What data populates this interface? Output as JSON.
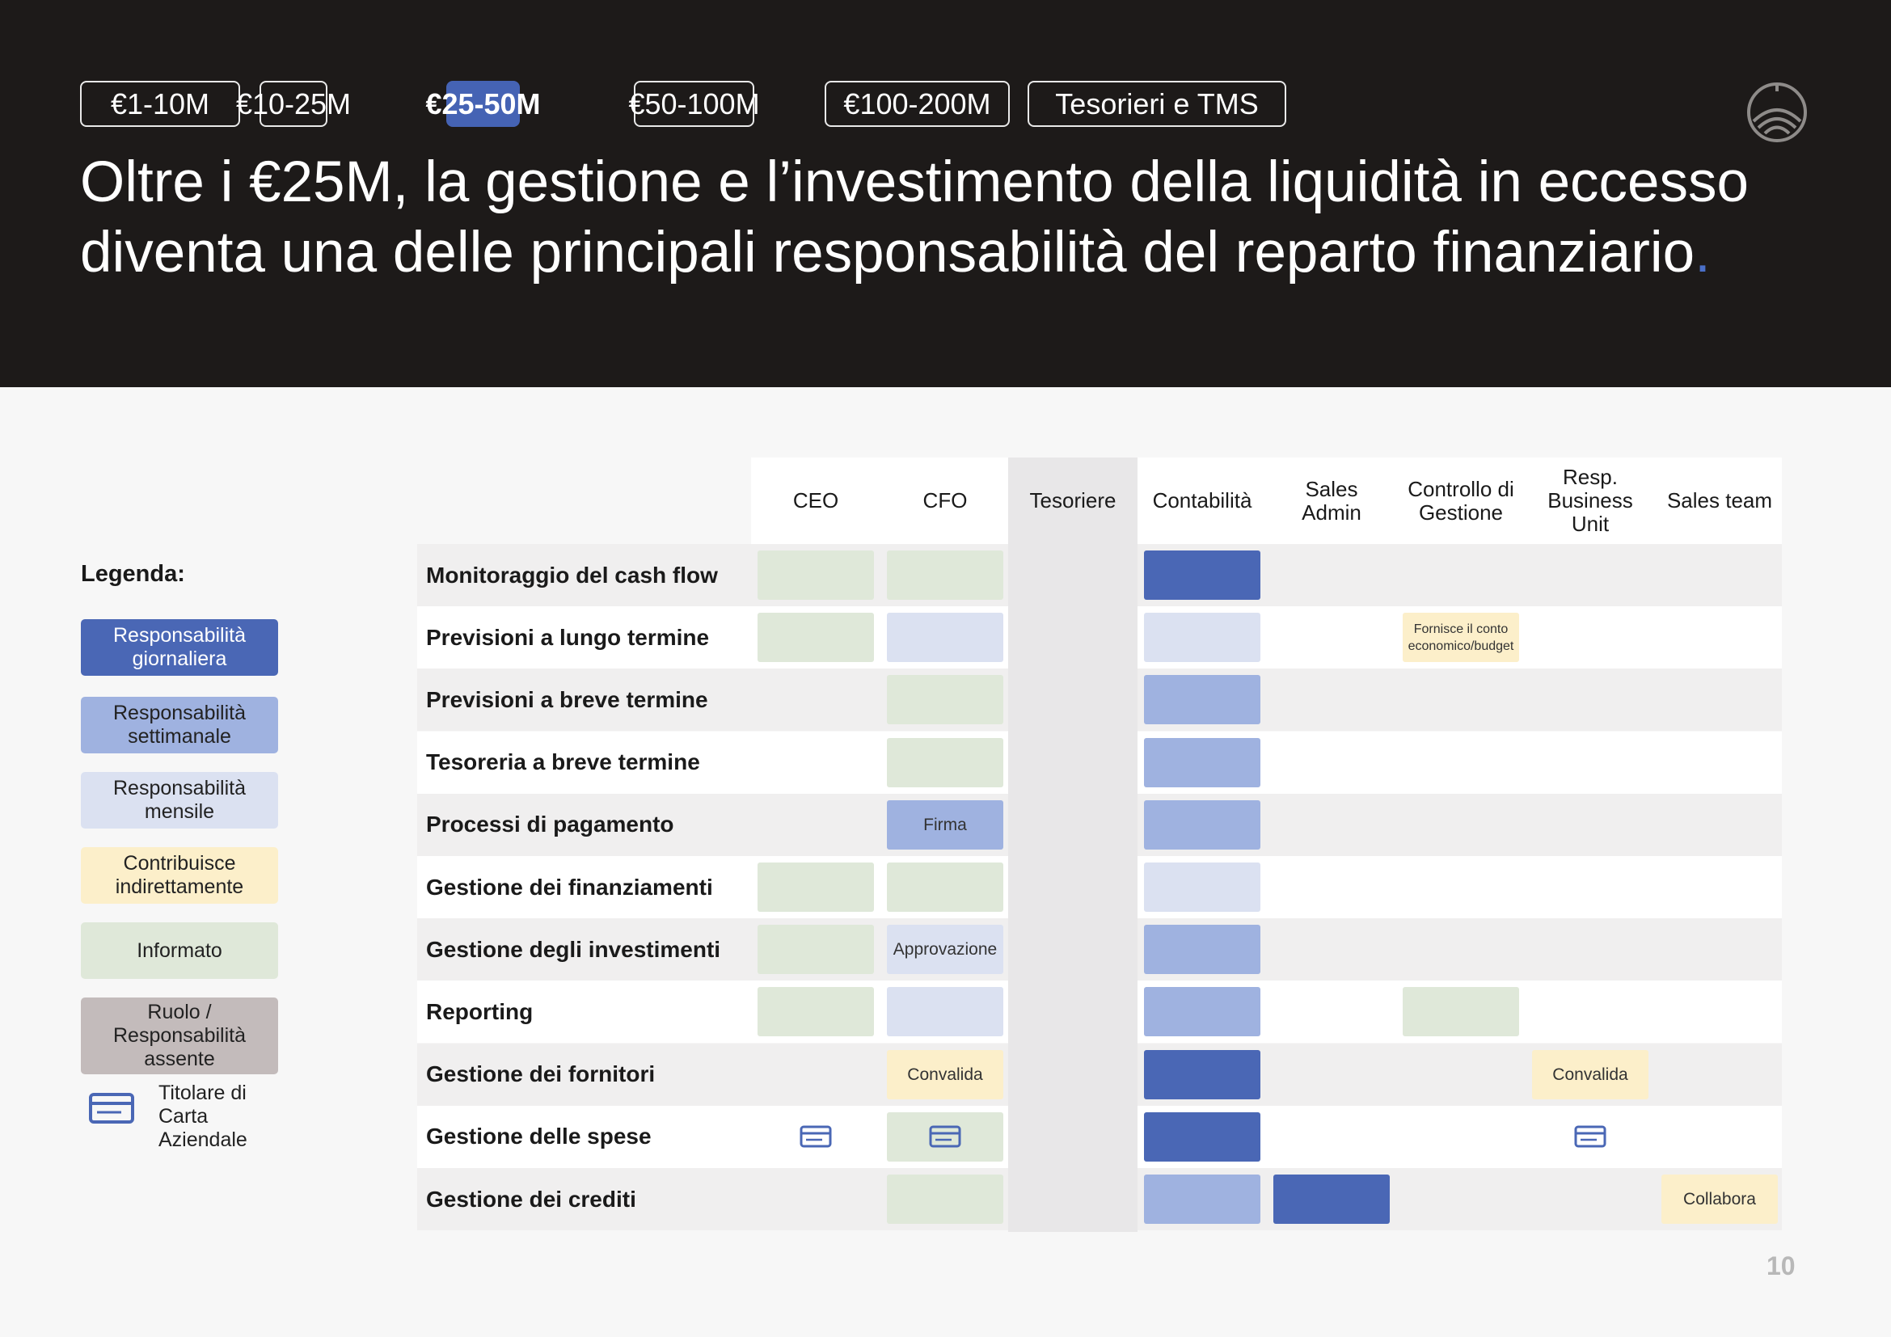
{
  "tabs": [
    {
      "label": "€1-10M",
      "active": false
    },
    {
      "label": "€10-25M",
      "active": false
    },
    {
      "label": "€25-50M",
      "active": true
    },
    {
      "label": "€50-100M",
      "active": false
    },
    {
      "label": "€100-200M",
      "active": false
    },
    {
      "label": "Tesorieri e TMS",
      "active": false
    }
  ],
  "title": {
    "text": "Oltre i €25M, la gestione e l’investimento della liquidità in eccesso diventa una delle principali responsabilità del reparto finanziario",
    "dot": "."
  },
  "legend": {
    "title": "Legenda:",
    "items": [
      {
        "label": "Responsabilità giornaliera",
        "color": "#4a67b5",
        "text_color": "#ffffff"
      },
      {
        "label": "Responsabilità settimanale",
        "color": "#9fb2e0",
        "text_color": "#222222"
      },
      {
        "label": "Responsabilità mensile",
        "color": "#dbe1f1",
        "text_color": "#222222"
      },
      {
        "label": "Contribuisce indirettamente",
        "color": "#fcefca",
        "text_color": "#222222"
      },
      {
        "label": "Informato",
        "color": "#dfe8d9",
        "text_color": "#222222"
      },
      {
        "label": "Ruolo / Responsabilità assente",
        "color": "#c3bbbb",
        "text_color": "#222222"
      }
    ],
    "card_owner": {
      "label": "Titolare di Carta Aziendale",
      "icon": "credit-card-icon"
    }
  },
  "columns": [
    "CEO",
    "CFO",
    "Tesoriere",
    "Contabilità",
    "Sales Admin",
    "Controllo di Gestione",
    "Resp. Business Unit",
    "Sales team"
  ],
  "colors": {
    "daily": "#4a67b5",
    "weekly": "#9fb2e0",
    "monthly": "#dbe1f1",
    "indirect": "#fcefca",
    "informed": "#dfe8d9"
  },
  "rows": [
    {
      "label": "Monitoraggio del cash flow"
    },
    {
      "label": "Previsioni a lungo termine"
    },
    {
      "label": "Previsioni a breve termine"
    },
    {
      "label": "Tesoreria a breve termine"
    },
    {
      "label": "Processi di pagamento"
    },
    {
      "label": "Gestione dei finanziamenti"
    },
    {
      "label": "Gestione degli investimenti"
    },
    {
      "label": "Reporting"
    },
    {
      "label": "Gestione dei fornitori"
    },
    {
      "label": "Gestione delle spese"
    },
    {
      "label": "Gestione dei crediti"
    }
  ],
  "cells": [
    {
      "row": 0,
      "col": 0,
      "level": "informed"
    },
    {
      "row": 0,
      "col": 1,
      "level": "informed"
    },
    {
      "row": 0,
      "col": 3,
      "level": "daily"
    },
    {
      "row": 1,
      "col": 0,
      "level": "informed"
    },
    {
      "row": 1,
      "col": 1,
      "level": "monthly"
    },
    {
      "row": 1,
      "col": 3,
      "level": "monthly"
    },
    {
      "row": 1,
      "col": 5,
      "level": "indirect",
      "text": "Fornisce il conto economico/budget"
    },
    {
      "row": 2,
      "col": 1,
      "level": "informed"
    },
    {
      "row": 2,
      "col": 3,
      "level": "weekly"
    },
    {
      "row": 3,
      "col": 1,
      "level": "informed"
    },
    {
      "row": 3,
      "col": 3,
      "level": "weekly"
    },
    {
      "row": 4,
      "col": 1,
      "level": "weekly",
      "text": "Firma"
    },
    {
      "row": 4,
      "col": 3,
      "level": "weekly"
    },
    {
      "row": 5,
      "col": 0,
      "level": "informed"
    },
    {
      "row": 5,
      "col": 1,
      "level": "informed"
    },
    {
      "row": 5,
      "col": 3,
      "level": "monthly"
    },
    {
      "row": 6,
      "col": 0,
      "level": "informed"
    },
    {
      "row": 6,
      "col": 1,
      "level": "monthly",
      "text": "Approvazione"
    },
    {
      "row": 6,
      "col": 3,
      "level": "weekly"
    },
    {
      "row": 7,
      "col": 0,
      "level": "informed"
    },
    {
      "row": 7,
      "col": 1,
      "level": "monthly"
    },
    {
      "row": 7,
      "col": 3,
      "level": "weekly"
    },
    {
      "row": 7,
      "col": 5,
      "level": "informed"
    },
    {
      "row": 8,
      "col": 1,
      "level": "indirect",
      "text": "Convalida"
    },
    {
      "row": 8,
      "col": 3,
      "level": "daily"
    },
    {
      "row": 8,
      "col": 6,
      "level": "indirect",
      "text": "Convalida"
    },
    {
      "row": 9,
      "col": 0,
      "level": "none",
      "card": true
    },
    {
      "row": 9,
      "col": 1,
      "level": "informed",
      "card": true
    },
    {
      "row": 9,
      "col": 3,
      "level": "daily"
    },
    {
      "row": 9,
      "col": 6,
      "level": "none",
      "card": true
    },
    {
      "row": 10,
      "col": 1,
      "level": "informed"
    },
    {
      "row": 10,
      "col": 3,
      "level": "weekly"
    },
    {
      "row": 10,
      "col": 4,
      "level": "daily"
    },
    {
      "row": 10,
      "col": 7,
      "level": "indirect",
      "text": "Collabora"
    }
  ],
  "page_number": "10"
}
